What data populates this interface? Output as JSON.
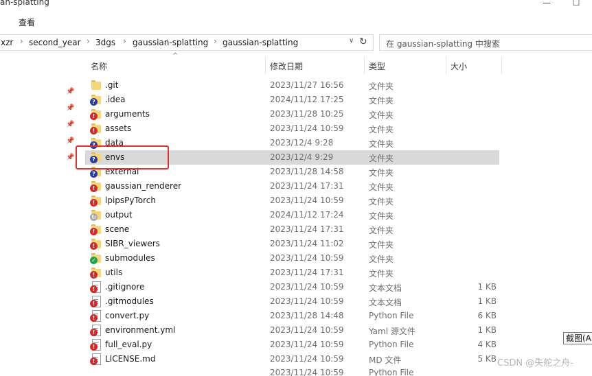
{
  "window": {
    "title": "an-splatting",
    "minimize_glyph": "—",
    "maximize_glyph": "☐"
  },
  "ribbon": {
    "view_tab": "查看"
  },
  "address": {
    "crumbs": [
      "xzr",
      "second_year",
      "3dgs",
      "gaussian-splatting",
      "gaussian-splatting"
    ],
    "separator": "›",
    "dropdown": "∨",
    "refresh": "↻"
  },
  "search": {
    "placeholder": "在 gaussian-splatting 中搜索"
  },
  "columns": {
    "name": "名称",
    "date": "修改日期",
    "type": "类型",
    "size": "大小",
    "sort_glyph": "^"
  },
  "files": [
    {
      "name": ".git",
      "date": "2023/11/27 16:56",
      "type": "文件夹",
      "size": "",
      "icon": "folder-icon",
      "badge": "none"
    },
    {
      "name": ".idea",
      "date": "2024/11/12 17:25",
      "type": "文件夹",
      "size": "",
      "icon": "folder-icon",
      "badge": "unknown"
    },
    {
      "name": "arguments",
      "date": "2023/11/28 10:25",
      "type": "文件夹",
      "size": "",
      "icon": "folder-icon",
      "badge": "error"
    },
    {
      "name": "assets",
      "date": "2023/11/24 10:59",
      "type": "文件夹",
      "size": "",
      "icon": "folder-icon",
      "badge": "error"
    },
    {
      "name": "data",
      "date": "2023/12/4 9:28",
      "type": "文件夹",
      "size": "",
      "icon": "folder-icon",
      "badge": "unknown"
    },
    {
      "name": "envs",
      "date": "2023/12/4 9:29",
      "type": "文件夹",
      "size": "",
      "icon": "folder-icon",
      "badge": "unknown",
      "selected": true
    },
    {
      "name": "external",
      "date": "2023/11/28 14:58",
      "type": "文件夹",
      "size": "",
      "icon": "folder-icon",
      "badge": "unknown"
    },
    {
      "name": "gaussian_renderer",
      "date": "2023/11/24 17:31",
      "type": "文件夹",
      "size": "",
      "icon": "folder-icon",
      "badge": "error"
    },
    {
      "name": "lpipsPyTorch",
      "date": "2023/11/24 10:59",
      "type": "文件夹",
      "size": "",
      "icon": "folder-icon",
      "badge": "error"
    },
    {
      "name": "output",
      "date": "2024/11/12 17:24",
      "type": "文件夹",
      "size": "",
      "icon": "folder-icon",
      "badge": "sync"
    },
    {
      "name": "scene",
      "date": "2023/11/24 17:31",
      "type": "文件夹",
      "size": "",
      "icon": "folder-icon",
      "badge": "error"
    },
    {
      "name": "SIBR_viewers",
      "date": "2023/11/24 11:02",
      "type": "文件夹",
      "size": "",
      "icon": "folder-icon",
      "badge": "error"
    },
    {
      "name": "submodules",
      "date": "2023/11/24 10:59",
      "type": "文件夹",
      "size": "",
      "icon": "folder-icon",
      "badge": "ok"
    },
    {
      "name": "utils",
      "date": "2023/11/24 17:31",
      "type": "文件夹",
      "size": "",
      "icon": "folder-icon",
      "badge": "error"
    },
    {
      "name": ".gitignore",
      "date": "2023/11/24 10:59",
      "type": "文本文档",
      "size": "1 KB",
      "icon": "text-file-icon",
      "badge": "error"
    },
    {
      "name": ".gitmodules",
      "date": "2023/11/24 10:59",
      "type": "文本文档",
      "size": "1 KB",
      "icon": "text-file-icon",
      "badge": "error"
    },
    {
      "name": "convert.py",
      "date": "2023/11/28 14:48",
      "type": "Python File",
      "size": "6 KB",
      "icon": "python-file-icon",
      "badge": "error"
    },
    {
      "name": "environment.yml",
      "date": "2023/11/24 10:59",
      "type": "Yaml 源文件",
      "size": "1 KB",
      "icon": "yaml-file-icon",
      "badge": "error"
    },
    {
      "name": "full_eval.py",
      "date": "2023/11/24 10:59",
      "type": "Python File",
      "size": "4 KB",
      "icon": "python-file-icon",
      "badge": "error"
    },
    {
      "name": "LICENSE.md",
      "date": "2023/11/24 10:59",
      "type": "MD 文件",
      "size": "5 KB",
      "icon": "md-file-icon",
      "badge": "error"
    }
  ],
  "partial_row": {
    "date": "2023/11/24 10:59",
    "type": "Python File"
  },
  "tooltip": {
    "text": "截图(Al"
  },
  "watermark": {
    "text": "CSDN @失舵之舟-"
  },
  "colors": {
    "selection": "#d9d9d9",
    "highlight": "#e53030",
    "error": "#d62828",
    "unknown": "#2a3b9e",
    "ok": "#22a34a",
    "folder": "#f5d67b"
  }
}
